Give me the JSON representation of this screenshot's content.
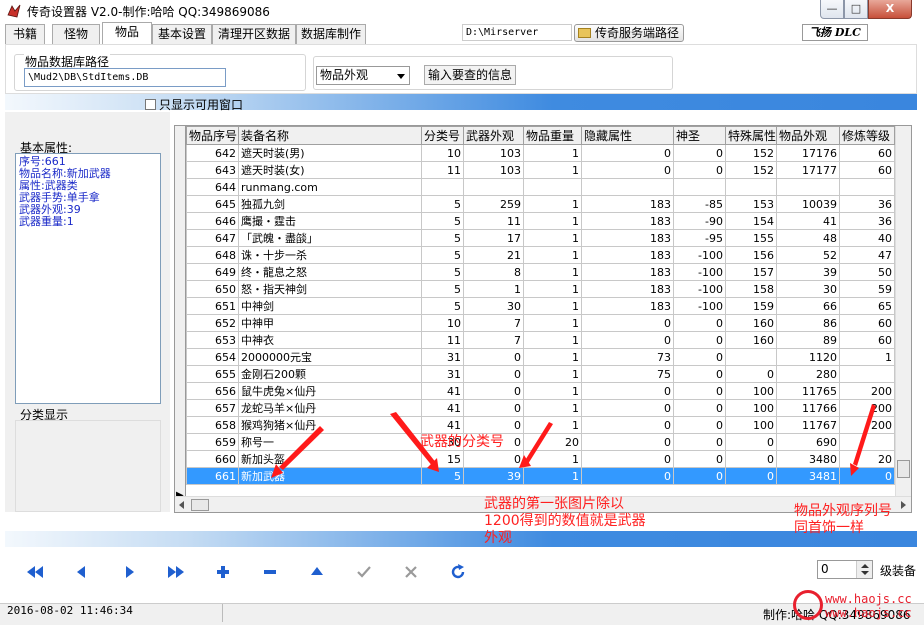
{
  "window": {
    "title": "传奇设置器 V2.0-制作:哈哈 QQ:349869086",
    "min_label": "—",
    "max_label": "□",
    "close_label": "X"
  },
  "tabs": [
    {
      "label": "书籍"
    },
    {
      "label": "怪物"
    },
    {
      "label": "物品"
    },
    {
      "label": "基本设置"
    },
    {
      "label": "清理开区数据"
    },
    {
      "label": "数据库制作"
    }
  ],
  "toolbar": {
    "server_path": "D:\\Mirserver",
    "server_path_button": "传奇服务端路径",
    "logo": "飞扬 DLC"
  },
  "db_group": {
    "label": "物品数据库路径",
    "path": "\\Mud2\\DB\\StdItems.DB"
  },
  "query": {
    "select_value": "物品外观",
    "info_button": "输入要查的信息"
  },
  "filter": {
    "checkbox_label": "只显示可用窗口"
  },
  "base_props": {
    "label": "基本属性:",
    "lines": [
      "序号:661",
      "物品名称:新加武器",
      "属性:武器类",
      "武器手势:单手拿",
      "武器外观:39",
      "武器重量:1"
    ]
  },
  "class_label": "分类显示",
  "grid": {
    "columns": [
      "物品序号",
      "装备名称",
      "分类号",
      "武器外观",
      "物品重量",
      "隐藏属性",
      "神圣",
      "特殊属性",
      "物品外观",
      "修炼等级"
    ],
    "rows": [
      [
        "642",
        "遮天时装(男)",
        "10",
        "103",
        "1",
        "0",
        "0",
        "152",
        "17176",
        "60"
      ],
      [
        "643",
        "遮天时装(女)",
        "11",
        "103",
        "1",
        "0",
        "0",
        "152",
        "17177",
        "60"
      ],
      [
        "644",
        "runmang.com",
        "",
        "",
        "",
        "",
        "",
        "",
        "",
        ""
      ],
      [
        "645",
        "独孤九剑",
        "5",
        "259",
        "1",
        "183",
        "-85",
        "153",
        "10039",
        "36"
      ],
      [
        "646",
        "鹰撮・霆击",
        "5",
        "11",
        "1",
        "183",
        "-90",
        "154",
        "41",
        "36"
      ],
      [
        "647",
        "「武魄・盡燄」",
        "5",
        "17",
        "1",
        "183",
        "-95",
        "155",
        "48",
        "40"
      ],
      [
        "648",
        "诛・十步一杀",
        "5",
        "21",
        "1",
        "183",
        "-100",
        "156",
        "52",
        "47"
      ],
      [
        "649",
        "终・龍息之怒",
        "5",
        "8",
        "1",
        "183",
        "-100",
        "157",
        "39",
        "50"
      ],
      [
        "650",
        "怒・指天神剑",
        "5",
        "1",
        "1",
        "183",
        "-100",
        "158",
        "30",
        "59"
      ],
      [
        "651",
        "中神剑",
        "5",
        "30",
        "1",
        "183",
        "-100",
        "159",
        "66",
        "65"
      ],
      [
        "652",
        "中神甲",
        "10",
        "7",
        "1",
        "0",
        "0",
        "160",
        "86",
        "60"
      ],
      [
        "653",
        "中神衣",
        "11",
        "7",
        "1",
        "0",
        "0",
        "160",
        "89",
        "60"
      ],
      [
        "654",
        "2000000元宝",
        "31",
        "0",
        "1",
        "73",
        "0",
        "",
        "1120",
        "1"
      ],
      [
        "655",
        "金刚石200颗",
        "31",
        "0",
        "1",
        "75",
        "0",
        "0",
        "280",
        ""
      ],
      [
        "656",
        "鼠牛虎兔×仙丹",
        "41",
        "0",
        "1",
        "0",
        "0",
        "100",
        "11765",
        "200"
      ],
      [
        "657",
        "龙蛇马羊×仙丹",
        "41",
        "0",
        "1",
        "0",
        "0",
        "100",
        "11766",
        "200"
      ],
      [
        "658",
        "猴鸡狗猪×仙丹",
        "41",
        "0",
        "1",
        "0",
        "0",
        "100",
        "11767",
        "200"
      ],
      [
        "659",
        "称号一",
        "30",
        "0",
        "20",
        "0",
        "0",
        "0",
        "690",
        ""
      ],
      [
        "660",
        "新加头盔",
        "15",
        "0",
        "1",
        "0",
        "0",
        "0",
        "3480",
        "20"
      ],
      [
        "661",
        "新加武器",
        "5",
        "39",
        "1",
        "0",
        "0",
        "0",
        "3481",
        "0"
      ]
    ],
    "selected_index": 19
  },
  "nav": {
    "spin_value": "0",
    "spin_label": "级装备"
  },
  "status": {
    "datetime": "2016-08-02  11:46:34",
    "author": "制作:哈哈  QQ:349869086"
  },
  "watermark": {
    "line1": "www.haojs.cc",
    "line2": "www.haojs.cc"
  },
  "annotations": {
    "classnum": "武器的分类号",
    "weapon_look": "武器的第一张图片除以\n1200得到的数值就是武器\n外观",
    "item_look": "物品外观序列号\n同首饰一样"
  },
  "colors": {
    "selection": "#3399ff",
    "annotation": "#ff2020",
    "base_text": "#1a29c8"
  }
}
